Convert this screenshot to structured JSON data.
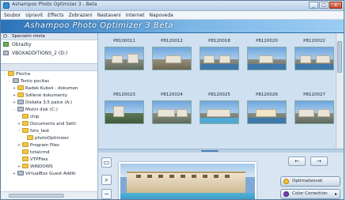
{
  "window": {
    "title": "Ashampoo Photo Optimizer 3 - Beta",
    "controls": [
      "_",
      "□",
      "x"
    ]
  },
  "menu": [
    "Soubor",
    "Upravit",
    "Effects",
    "Zobrazeni",
    "Nastaveni",
    "Internet",
    "Napoveda"
  ],
  "brand": "Ashampoo Photo Optimizer 3 Beta",
  "sidebar": {
    "special_header": "Specialni mista",
    "favorites": [
      "Obrazky",
      "VBOXADDITIONS_2 (D:)"
    ],
    "tree": [
      {
        "label": "Plocha",
        "level": 0,
        "type": "folder"
      },
      {
        "label": "Tento pocitac",
        "level": 1,
        "type": "folder"
      },
      {
        "label": "Radek Kubeš - dokumen",
        "level": 2,
        "type": "folder"
      },
      {
        "label": "Sdilené dokumenty",
        "level": 2,
        "type": "folder"
      },
      {
        "label": "Disketa 3,5 palce (A:)",
        "level": 2,
        "type": "drive"
      },
      {
        "label": "Mistni disk (C:)",
        "level": 2,
        "type": "drive"
      },
      {
        "label": "chip",
        "level": 3,
        "type": "folder"
      },
      {
        "label": "Documents and Setti",
        "level": 3,
        "type": "folder"
      },
      {
        "label": "foto_test",
        "level": 3,
        "type": "folder"
      },
      {
        "label": "photoOptimizer",
        "level": 4,
        "type": "folder"
      },
      {
        "label": "Program Files",
        "level": 3,
        "type": "folder"
      },
      {
        "label": "totalcmd",
        "level": 3,
        "type": "folder"
      },
      {
        "label": "VTPFiles",
        "level": 3,
        "type": "folder"
      },
      {
        "label": "WINDOWS",
        "level": 3,
        "type": "folder"
      },
      {
        "label": "VirtualBox Guest Additi",
        "level": 2,
        "type": "drive"
      }
    ]
  },
  "thumbnails": [
    {
      "label": "P8100011"
    },
    {
      "label": "P8120012"
    },
    {
      "label": "P8120018"
    },
    {
      "label": "P8120020"
    },
    {
      "label": "P8120022"
    },
    {
      "label": "P8120023"
    },
    {
      "label": "P8120024"
    },
    {
      "label": "P8120025"
    },
    {
      "label": "P8120026"
    },
    {
      "label": "P8120027"
    }
  ],
  "buttons": {
    "back": "←",
    "forward": "→",
    "optimize": "Optimalizovat",
    "color_correction": "Color Correction"
  },
  "colors": {
    "header_blue": "#2a73b8",
    "panel_blue": "#cfe1f1"
  }
}
